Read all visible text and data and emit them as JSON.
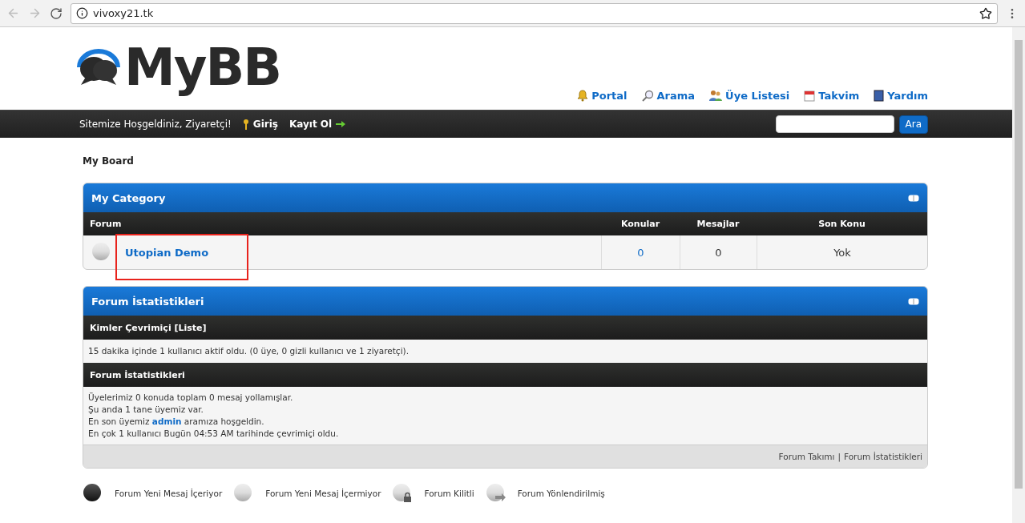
{
  "browser": {
    "url": "vivoxy21.tk"
  },
  "header": {
    "logo": "MyBB",
    "menu": [
      {
        "label": "Portal",
        "kind": "bell"
      },
      {
        "label": "Arama",
        "kind": "search"
      },
      {
        "label": "Üye Listesi",
        "kind": "users"
      },
      {
        "label": "Takvim",
        "kind": "calendar"
      },
      {
        "label": "Yardım",
        "kind": "help"
      }
    ]
  },
  "panel": {
    "welcome": "Sitemize Hoşgeldiniz, Ziyaretçi!",
    "login": "Giriş",
    "register": "Kayıt Ol",
    "search_button": "Ara"
  },
  "breadcrumb": "My Board",
  "category": {
    "title": "My Category",
    "columns": [
      "Forum",
      "Konular",
      "Mesajlar",
      "Son Konu"
    ],
    "rows": [
      {
        "name": "Utopian Demo",
        "topics": "0",
        "posts": "0",
        "last_post": "Yok",
        "highlighted": true
      }
    ]
  },
  "stats": {
    "title": "Forum İstatistikleri",
    "online_heading": "Kimler Çevrimiçi [Liste]",
    "online_text": "15 dakika içinde 1 kullanıcı aktif oldu. (0 üye, 0 gizli kullanıcı ve 1 ziyaretçi).",
    "stats_heading": "Forum İstatistikleri",
    "lines": [
      {
        "parts": [
          {
            "kind": "text",
            "text": "Üyelerimiz 0 konuda toplam 0 mesaj yollamışlar."
          }
        ]
      },
      {
        "parts": [
          {
            "kind": "text",
            "text": "Şu anda 1 tane üyemiz var."
          }
        ]
      },
      {
        "parts": [
          {
            "kind": "text",
            "text": "En son üyemiz "
          },
          {
            "kind": "link",
            "text": "admin"
          },
          {
            "kind": "text",
            "text": " aramıza hoşgeldin."
          }
        ]
      },
      {
        "parts": [
          {
            "kind": "text",
            "text": "En çok 1 kullanıcı Bugün 04:53 AM tarihinde çevrimiçi oldu."
          }
        ]
      }
    ],
    "footer_links": [
      "Forum Takımı",
      "Forum İstatistikleri"
    ],
    "separator": "|"
  },
  "legend": [
    {
      "kind": "new",
      "label": "Forum Yeni Mesaj İçeriyor"
    },
    {
      "kind": "nonew",
      "label": "Forum Yeni Mesaj İçermiyor"
    },
    {
      "kind": "locked",
      "label": "Forum Kilitli"
    },
    {
      "kind": "redirect",
      "label": "Forum Yönlendirilmiş"
    }
  ]
}
